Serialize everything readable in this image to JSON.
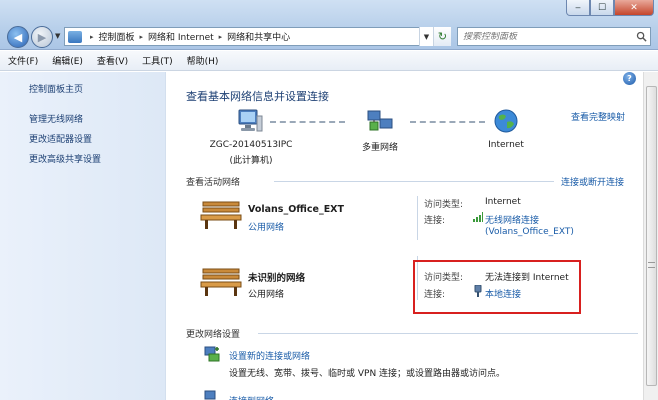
{
  "window": {
    "btn_min": "‒",
    "btn_max": "☐",
    "btn_close": "✕"
  },
  "address": {
    "crumbs": [
      "控制面板",
      "网络和 Internet",
      "网络和共享中心"
    ],
    "search_placeholder": "搜索控制面板"
  },
  "menu": [
    "文件(F)",
    "编辑(E)",
    "查看(V)",
    "工具(T)",
    "帮助(H)"
  ],
  "sidebar": {
    "home": "控制面板主页",
    "links": [
      "管理无线网络",
      "更改适配器设置",
      "更改高级共享设置"
    ]
  },
  "main": {
    "title": "查看基本网络信息并设置连接",
    "view_full_map": "查看完整映射",
    "nodes": {
      "computer_name": "ZGC-20140513IPC",
      "computer_sub": "(此计算机)",
      "middle": "多重网络",
      "internet": "Internet"
    },
    "active_title": "查看活动网络",
    "connect_disconnect": "连接或断开连接",
    "networks": [
      {
        "name": "Volans_Office_EXT",
        "type": "公用网络",
        "access_label": "访问类型:",
        "access_value": "Internet",
        "conn_label": "连接:",
        "conn_value": "无线网络连接",
        "conn_value2": "(Volans_Office_EXT)"
      },
      {
        "name": "未识别的网络",
        "type": "公用网络",
        "access_label": "访问类型:",
        "access_value": "无法连接到 Internet",
        "conn_label": "连接:",
        "conn_value": "本地连接"
      }
    ],
    "change_title": "更改网络设置",
    "tasks": [
      {
        "link": "设置新的连接或网络",
        "desc": "设置无线、宽带、拨号、临时或 VPN 连接；或设置路由器或访问点。"
      },
      {
        "link": "连接到网络"
      }
    ]
  },
  "icons": {
    "help": "?",
    "back": "◀",
    "forward": "▶",
    "refresh": "↻",
    "dropdown": "▼"
  },
  "colors": {
    "link": "#1a5ca8",
    "heading": "#1c3f73",
    "highlight_box": "#d8201f"
  }
}
